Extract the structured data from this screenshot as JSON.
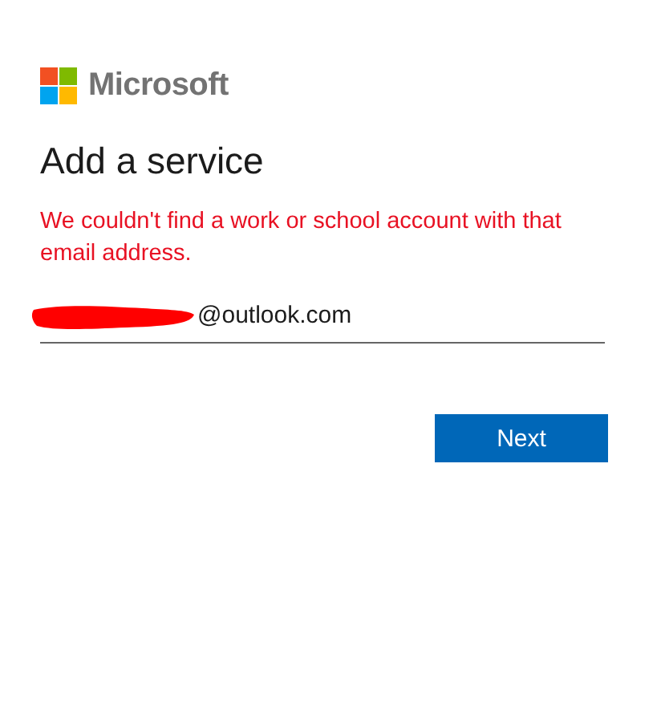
{
  "brand": {
    "name": "Microsoft"
  },
  "title": "Add a service",
  "error": "We couldn't find a work or school account with that email address.",
  "email_field": {
    "value": "@outlook.com",
    "redacted": true
  },
  "buttons": [
    "Next"
  ]
}
